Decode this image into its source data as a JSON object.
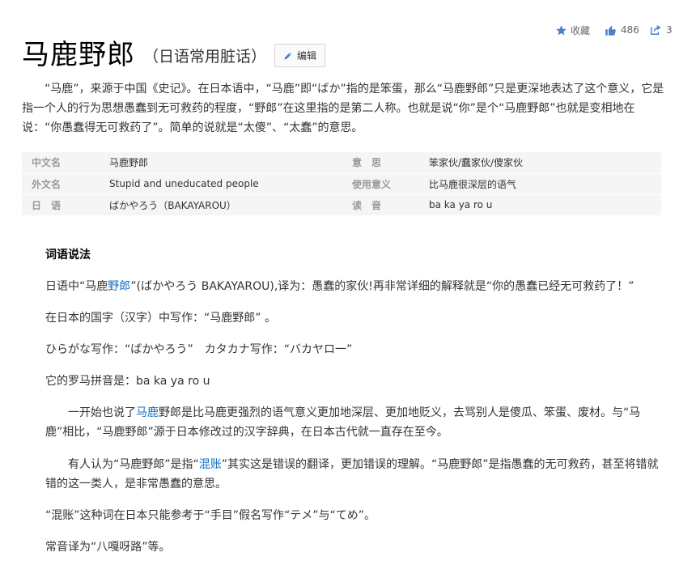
{
  "actions": {
    "favorite_label": "收藏",
    "like_count": "486",
    "share_count": "3"
  },
  "entry": {
    "title": "马鹿野郎",
    "subtitle": "（日语常用脏话）",
    "edit_label": "编辑"
  },
  "summary": "“马鹿”，来源于中国《史记》。在日本语中，“马鹿”即“ばか”指的是笨蛋，那么“马鹿野郎”只是更深地表达了这个意义，它是指一个人的行为思想愚蠢到无可救药的程度，“野郎”在这里指的是第二人称。也就是说“你”是个“马鹿野郎”也就是变相地在说：“你愚蠢得无可救药了”。简单的说就是“太傻”、“太蠢”的意思。",
  "info": [
    {
      "label1": "中文名",
      "value1": "马鹿野郎",
      "label2": "意　思",
      "value2": "笨家伙/蠢家伙/傻家伙"
    },
    {
      "label1": "外文名",
      "value1": "Stupid and uneducated people",
      "label2": "使用意义",
      "value2": "比马鹿很深层的语气"
    },
    {
      "label1": "日　语",
      "value1": "ばかやろう（BAKAYAROU）",
      "label2": "读　音",
      "value2": "ba ka ya ro u"
    }
  ],
  "section": {
    "title": "词语说法",
    "p1_before": "日语中“马鹿",
    "p1_link": "野郎",
    "p1_after": "”(ばかやろう BAKAYAROU),译为：愚蠢的家伙!再非常详细的解释就是“你的愚蠢已经无可救药了！”",
    "p2": "在日本的国字（汉字）中写作：“马鹿野郎” 。",
    "p3": "ひらがな写作：“ばかやろう”　カタカナ写作：“バカヤロ一”",
    "p4": "它的罗马拼音是：ba ka ya ro u",
    "p5_before": "一开始也说了",
    "p5_link": "马鹿",
    "p5_after": "野郎是比马鹿更强烈的语气意义更加地深层、更加地贬义，去骂别人是傻瓜、笨蛋、废材。与“马鹿”相比，“马鹿野郎”源于日本修改过的汉字辞典，在日本古代就一直存在至今。",
    "p6_before": "有人认为“马鹿野郎”是指“",
    "p6_link": "混账",
    "p6_after": "”其实这是错误的翻译，更加错误的理解。“马鹿野郎”是指愚蠢的无可救药，甚至将错就错的这一类人，是非常愚蠢的意思。",
    "p7": "“混账”这种词在日本只能参考于“手目”假名写作“テメ”与“てめ”。",
    "p8": "常音译为“八嘎呀路”等。"
  },
  "colors": {
    "link": "#136ec2",
    "icon_blue": "#4a7fcf",
    "label_gray": "#999999"
  }
}
